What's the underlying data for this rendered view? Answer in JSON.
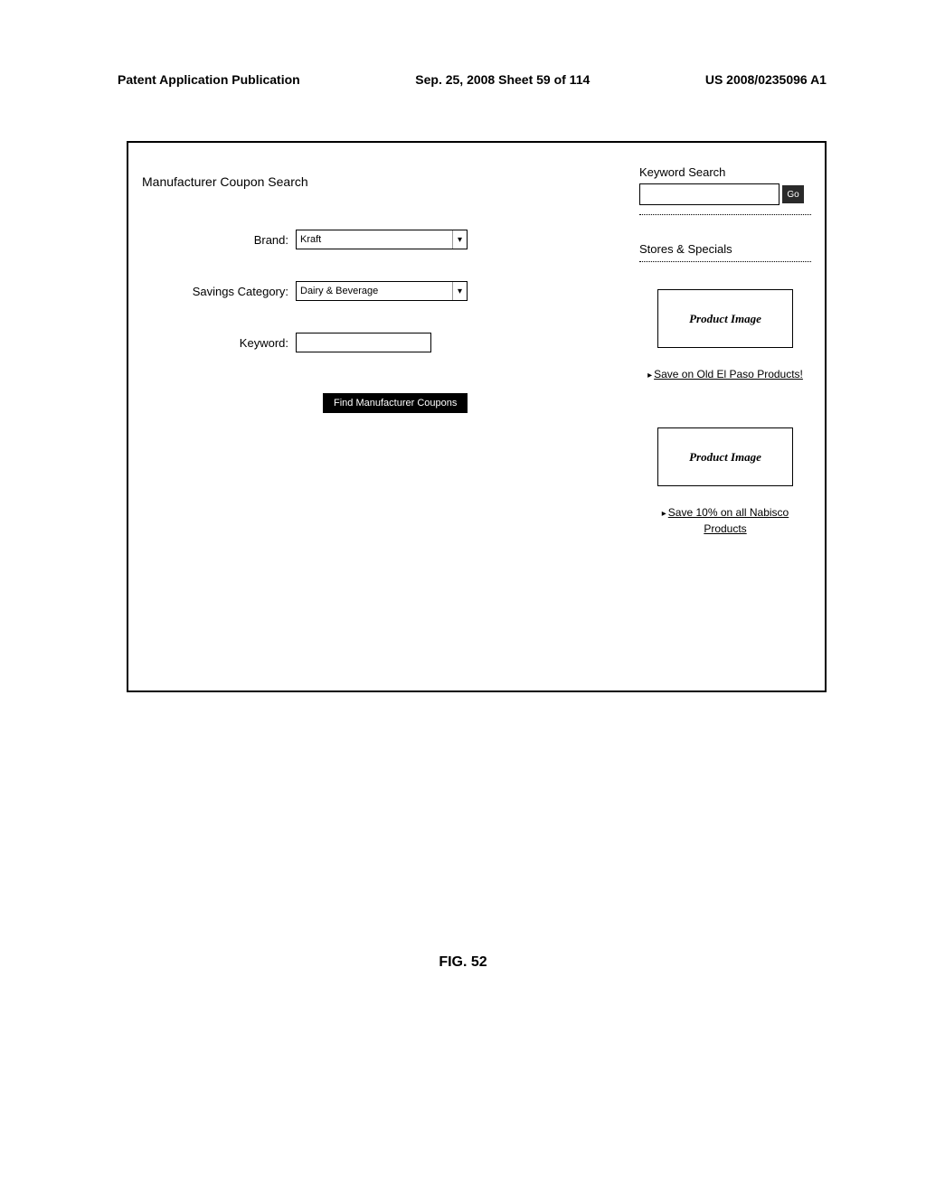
{
  "header": {
    "left": "Patent Application Publication",
    "center": "Sep. 25, 2008  Sheet 59 of 114",
    "right": "US 2008/0235096 A1"
  },
  "main": {
    "title": "Manufacturer Coupon Search",
    "brand": {
      "label": "Brand:",
      "value": "Kraft"
    },
    "category": {
      "label": "Savings Category:",
      "value": "Dairy & Beverage"
    },
    "keyword": {
      "label": "Keyword:",
      "value": ""
    },
    "find_button": "Find Manufacturer Coupons"
  },
  "sidebar": {
    "keyword_search": {
      "title": "Keyword Search",
      "go": "Go"
    },
    "stores_title": "Stores & Specials",
    "products": [
      {
        "image_text": "Product Image",
        "link": "Save on Old El Paso Products!"
      },
      {
        "image_text": "Product Image",
        "link": "Save 10% on all Nabisco Products"
      }
    ]
  },
  "figure_label": "FIG. 52"
}
